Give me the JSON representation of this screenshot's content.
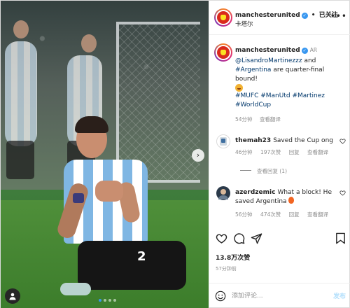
{
  "post": {
    "author": "manchesterunited",
    "follow_separator": "•",
    "follow_status": "已关注",
    "location": "卡塔尔",
    "caption": {
      "author": "manchesterunited",
      "badge": "AR",
      "mention": "@LisandroMartinezzz",
      "text_and": "and",
      "hashtag_country": "#Argentina",
      "text_rest": "are quarter-final bound!",
      "hashtags": [
        "#MUFC",
        "#ManUtd",
        "#Martinez",
        "#WorldCup"
      ],
      "age": "54分钟",
      "translate": "查看翻译"
    },
    "comments": [
      {
        "user": "themah23",
        "text": "Saved the Cup ong",
        "age": "46分钟",
        "likes": "197次赞",
        "reply": "回复",
        "translate": "查看翻译",
        "replies_label": "查看回复 (1)"
      },
      {
        "user": "azerdzemic",
        "text": "What a block! He saved Argentina",
        "age": "56分钟",
        "likes": "474次赞",
        "reply": "回复",
        "translate": "查看翻译"
      }
    ],
    "likes_count": "13.8万次赞",
    "timestamp": "57分钟前",
    "add_comment_placeholder": "添加评论...",
    "post_button": "发布"
  },
  "photo": {
    "jersey_number": "2",
    "carousel_total": 4,
    "carousel_active": 1
  },
  "colors": {
    "verified_blue": "#3897f0",
    "link_navy": "#00376b",
    "muted_gray": "#8e8e8e",
    "post_disabled": "#b2dffc",
    "brand_red": "#da291c"
  },
  "icons": [
    "verified-icon",
    "more-icon",
    "heart-icon",
    "comment-icon",
    "share-icon",
    "bookmark-icon",
    "emoji-icon",
    "tag-people-icon",
    "carousel-next-icon"
  ]
}
